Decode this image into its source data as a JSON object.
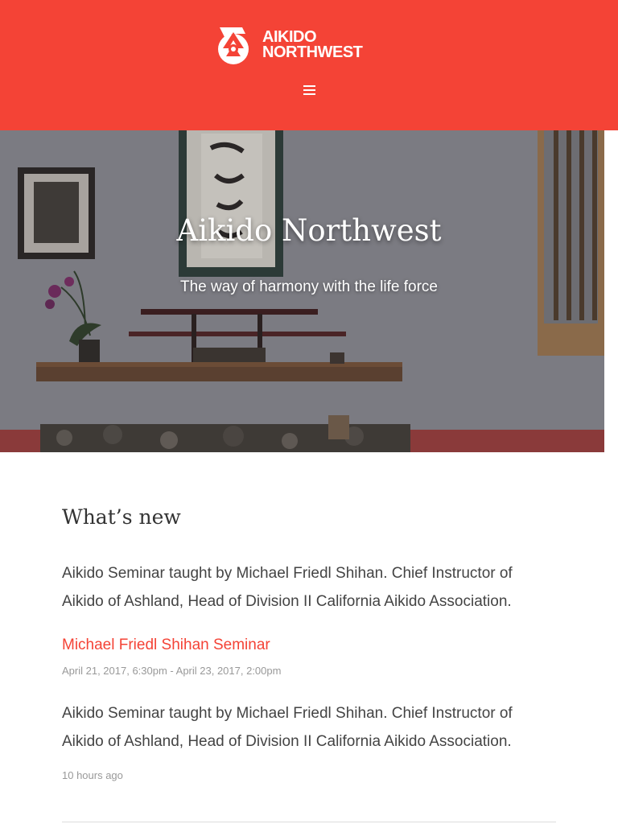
{
  "header": {
    "logo_line1": "AIKIDO",
    "logo_line2": "NORTHWEST",
    "logo_icon": "aikido-logo-icon",
    "menu_icon": "hamburger-menu-icon",
    "background_color": "#f44336"
  },
  "hero": {
    "title": "Aikido Northwest",
    "subtitle": "The way of harmony with the life force"
  },
  "whats_new": {
    "title": "What’s new",
    "intro": "Aikido Seminar taught by Michael Friedl Shihan. Chief Instructor of Aikido of Ashland, Head of Division II California Aikido Association.",
    "event": {
      "link_text": "Michael Friedl Shihan Seminar",
      "dates": "April 21, 2017, 6:30pm - April 23, 2017, 2:00pm",
      "description": "Aikido Seminar taught by Michael Friedl Shihan. Chief Instructor of Aikido of Ashland, Head of Division II California Aikido Association.",
      "posted": "10 hours ago"
    }
  },
  "colors": {
    "accent": "#f44336",
    "text": "#444444",
    "muted": "#999999"
  }
}
